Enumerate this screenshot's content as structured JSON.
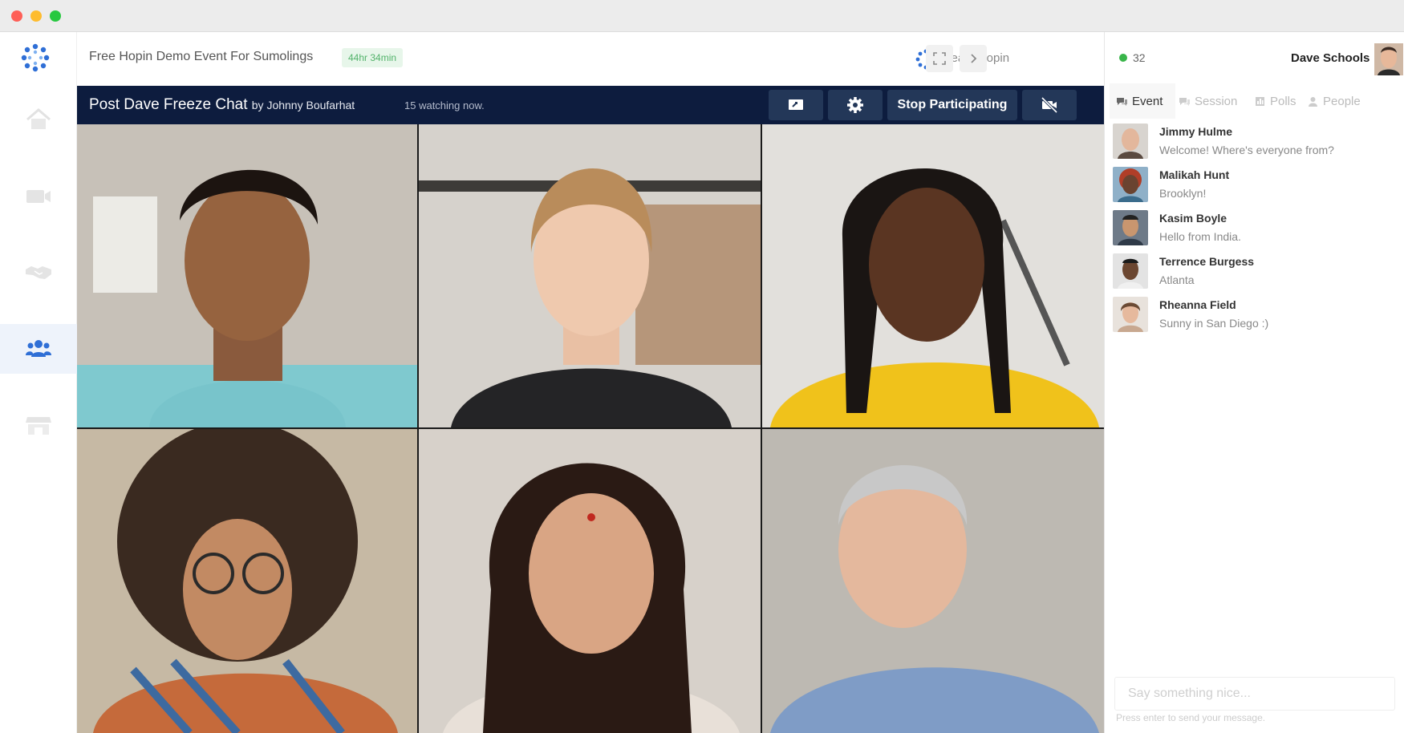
{
  "window": {
    "controls": [
      "close",
      "minimize",
      "maximize"
    ]
  },
  "sidebar": {
    "logo_icon": "hopin-logo-icon",
    "items": [
      {
        "name": "home",
        "icon": "home-icon"
      },
      {
        "name": "stage",
        "icon": "video-camera-icon"
      },
      {
        "name": "networking",
        "icon": "handshake-icon"
      },
      {
        "name": "sessions",
        "icon": "people-icon",
        "active": true
      },
      {
        "name": "expo",
        "icon": "booth-icon"
      }
    ]
  },
  "header": {
    "event_title": "Free Hopin Demo Event For Sumolings",
    "timer": "44hr 34min",
    "organizer": "Team Hopin",
    "fullscreen_icon": "fullscreen-icon",
    "collapse_icon": "chevron-right-icon"
  },
  "session": {
    "title": "Post Dave Freeze Chat",
    "by": "by Johnny Boufarhat",
    "watching": "15 watching now.",
    "share_icon": "screen-share-icon",
    "settings_icon": "gear-icon",
    "stop_label": "Stop Participating",
    "camera_off_icon": "camera-off-icon"
  },
  "video_tiles": [
    {
      "name": "participant-1"
    },
    {
      "name": "participant-2"
    },
    {
      "name": "participant-3"
    },
    {
      "name": "participant-4"
    },
    {
      "name": "participant-5"
    },
    {
      "name": "participant-6"
    }
  ],
  "panel": {
    "online_count": "32",
    "user_name": "Dave Schools",
    "tabs": [
      {
        "label": "Event",
        "icon": "chat-icon",
        "active": true
      },
      {
        "label": "Session",
        "icon": "chat-icon"
      },
      {
        "label": "Polls",
        "icon": "poll-icon"
      },
      {
        "label": "People",
        "icon": "person-icon"
      }
    ],
    "messages": [
      {
        "name": "Jimmy Hulme",
        "text": "Welcome! Where's everyone from?"
      },
      {
        "name": "Malikah Hunt",
        "text": "Brooklyn!"
      },
      {
        "name": "Kasim Boyle",
        "text": "Hello from India."
      },
      {
        "name": "Terrence Burgess",
        "text": "Atlanta"
      },
      {
        "name": "Rheanna Field",
        "text": "Sunny in San Diego :)"
      }
    ],
    "input_placeholder": "Say something nice...",
    "input_hint": "Press enter to send your message."
  },
  "colors": {
    "session_bar": "#0d1c3e",
    "session_button": "#233758",
    "timer_text": "#53b36b",
    "timer_bg": "#e7f6ea",
    "online": "#39b54a",
    "accent": "#2f6fd6"
  }
}
